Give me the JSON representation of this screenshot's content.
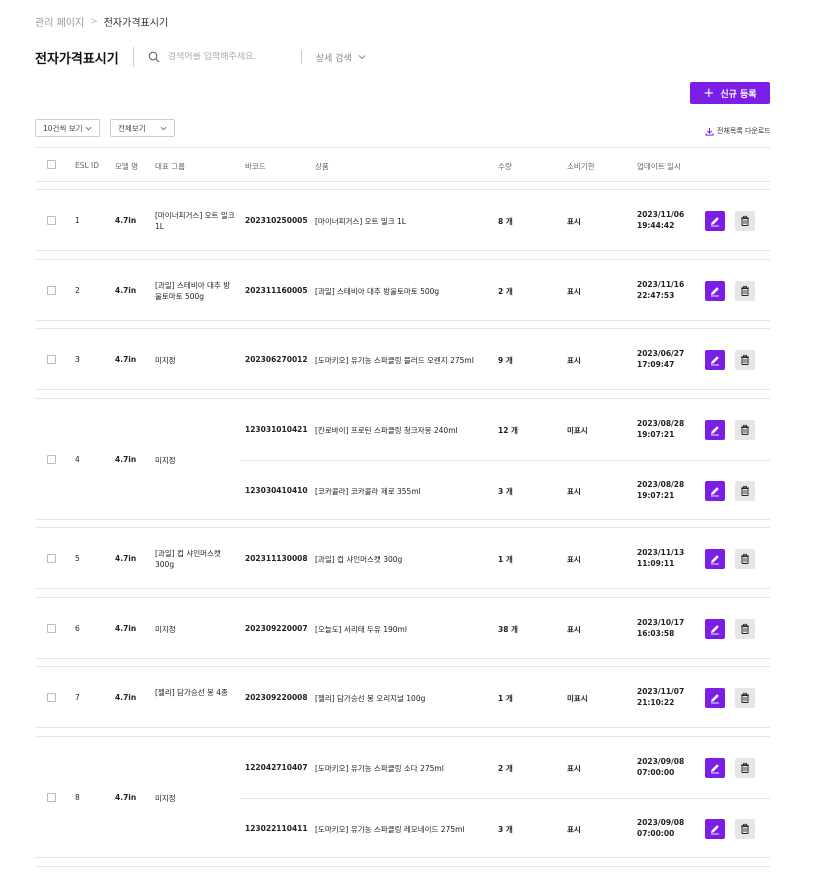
{
  "breadcrumb": {
    "root": "관리 페이지",
    "separator": ">",
    "current": "전자가격표시기"
  },
  "page": {
    "title": "전자가격표시기"
  },
  "search": {
    "placeholder": "검색어를 입력해주세요.",
    "value": ""
  },
  "detail_search": {
    "label": "상세 검색"
  },
  "new_button": {
    "label": "신규 등록",
    "icon": "plus-icon"
  },
  "filters": {
    "page_size": "10건씩 보기",
    "view": "전체보기"
  },
  "download": {
    "label": "전체목록 다운로드",
    "icon": "download-icon"
  },
  "colors": {
    "accent": "#7b1fe6",
    "delete_bg": "#e6e6e6",
    "border": "#e4e4e4"
  },
  "table": {
    "headers": {
      "esl_id": "ESL ID",
      "model": "모델 명",
      "group": "대표 그룹",
      "barcode": "바코드",
      "product": "상품",
      "qty": "수량",
      "expiry": "소비기한",
      "updated": "업데이트 일시"
    },
    "rows": [
      {
        "id": "1",
        "model": "4.7in",
        "group": "[마이너피거스] 오트 밀크 1L",
        "items": [
          {
            "barcode": "202310250005",
            "product": "[마이너피거스] 오트 밀크 1L",
            "qty": "8 개",
            "expiry": "표시",
            "date": "2023/11/06",
            "time": "19:44:42"
          }
        ]
      },
      {
        "id": "2",
        "model": "4.7in",
        "group": "[과일] 스테비아 대추 방울토마토 500g",
        "items": [
          {
            "barcode": "202311160005",
            "product": "[과일] 스테비아 대추 방울토마토 500g",
            "qty": "2 개",
            "expiry": "표시",
            "date": "2023/11/16",
            "time": "22:47:53"
          }
        ]
      },
      {
        "id": "3",
        "model": "4.7in",
        "group": "미지정",
        "items": [
          {
            "barcode": "202306270012",
            "product": "[도마키오] 유기농 스파클링 블러드 오렌지 275ml",
            "qty": "9 개",
            "expiry": "표시",
            "date": "2023/06/27",
            "time": "17:09:47"
          }
        ]
      },
      {
        "id": "4",
        "model": "4.7in",
        "group": "미지정",
        "items": [
          {
            "barcode": "123031010421",
            "product": "[칸로바이] 프로틴 스파클링 청크자몽 240ml",
            "qty": "12 개",
            "expiry": "미표시",
            "date": "2023/08/28",
            "time": "19:07:21"
          },
          {
            "barcode": "123030410410",
            "product": "[코카콜라] 코카콜라 제로 355ml",
            "qty": "3 개",
            "expiry": "표시",
            "date": "2023/08/28",
            "time": "19:07:21"
          }
        ]
      },
      {
        "id": "5",
        "model": "4.7in",
        "group": "[과일] 컵 샤인머스캣 300g",
        "items": [
          {
            "barcode": "202311130008",
            "product": "[과일] 컵 샤인머스캣 300g",
            "qty": "1 개",
            "expiry": "표시",
            "date": "2023/11/13",
            "time": "11:09:11"
          }
        ]
      },
      {
        "id": "6",
        "model": "4.7in",
        "group": "미지정",
        "items": [
          {
            "barcode": "202309220007",
            "product": "[오늘도] 서리태 두유 190ml",
            "qty": "38 개",
            "expiry": "표시",
            "date": "2023/10/17",
            "time": "16:03:58"
          }
        ]
      },
      {
        "id": "7",
        "model": "4.7in",
        "group": "[젤리] 담가승선 봉 4종",
        "items": [
          {
            "barcode": "202309220008",
            "product": "[젤리] 담가승선 봉 오리지널 100g",
            "qty": "1 개",
            "expiry": "미표시",
            "date": "2023/11/07",
            "time": "21:10:22"
          }
        ]
      },
      {
        "id": "8",
        "model": "4.7in",
        "group": "미지정",
        "items": [
          {
            "barcode": "122042710407",
            "product": "[도마키오] 유기농 스파클링 소다 275ml",
            "qty": "2 개",
            "expiry": "표시",
            "date": "2023/09/08",
            "time": "07:00:00"
          },
          {
            "barcode": "123022110411",
            "product": "[도마키오] 유기농 스파클링 레모네이드 275ml",
            "qty": "3 개",
            "expiry": "표시",
            "date": "2023/09/08",
            "time": "07:00:00"
          }
        ]
      }
    ]
  }
}
